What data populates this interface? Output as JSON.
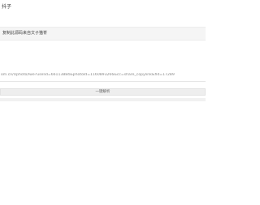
{
  "page": {
    "title": "抖子"
  },
  "notice": {
    "text": "复制此源码来自文子猫脊"
  },
  "url_input": {
    "value": "om.cn/Uphoto/lwe?useIid=66113884&photoId=1160893266&cc=share_copylink&fid=17289"
  },
  "parse_button": {
    "label": "一键解析"
  }
}
